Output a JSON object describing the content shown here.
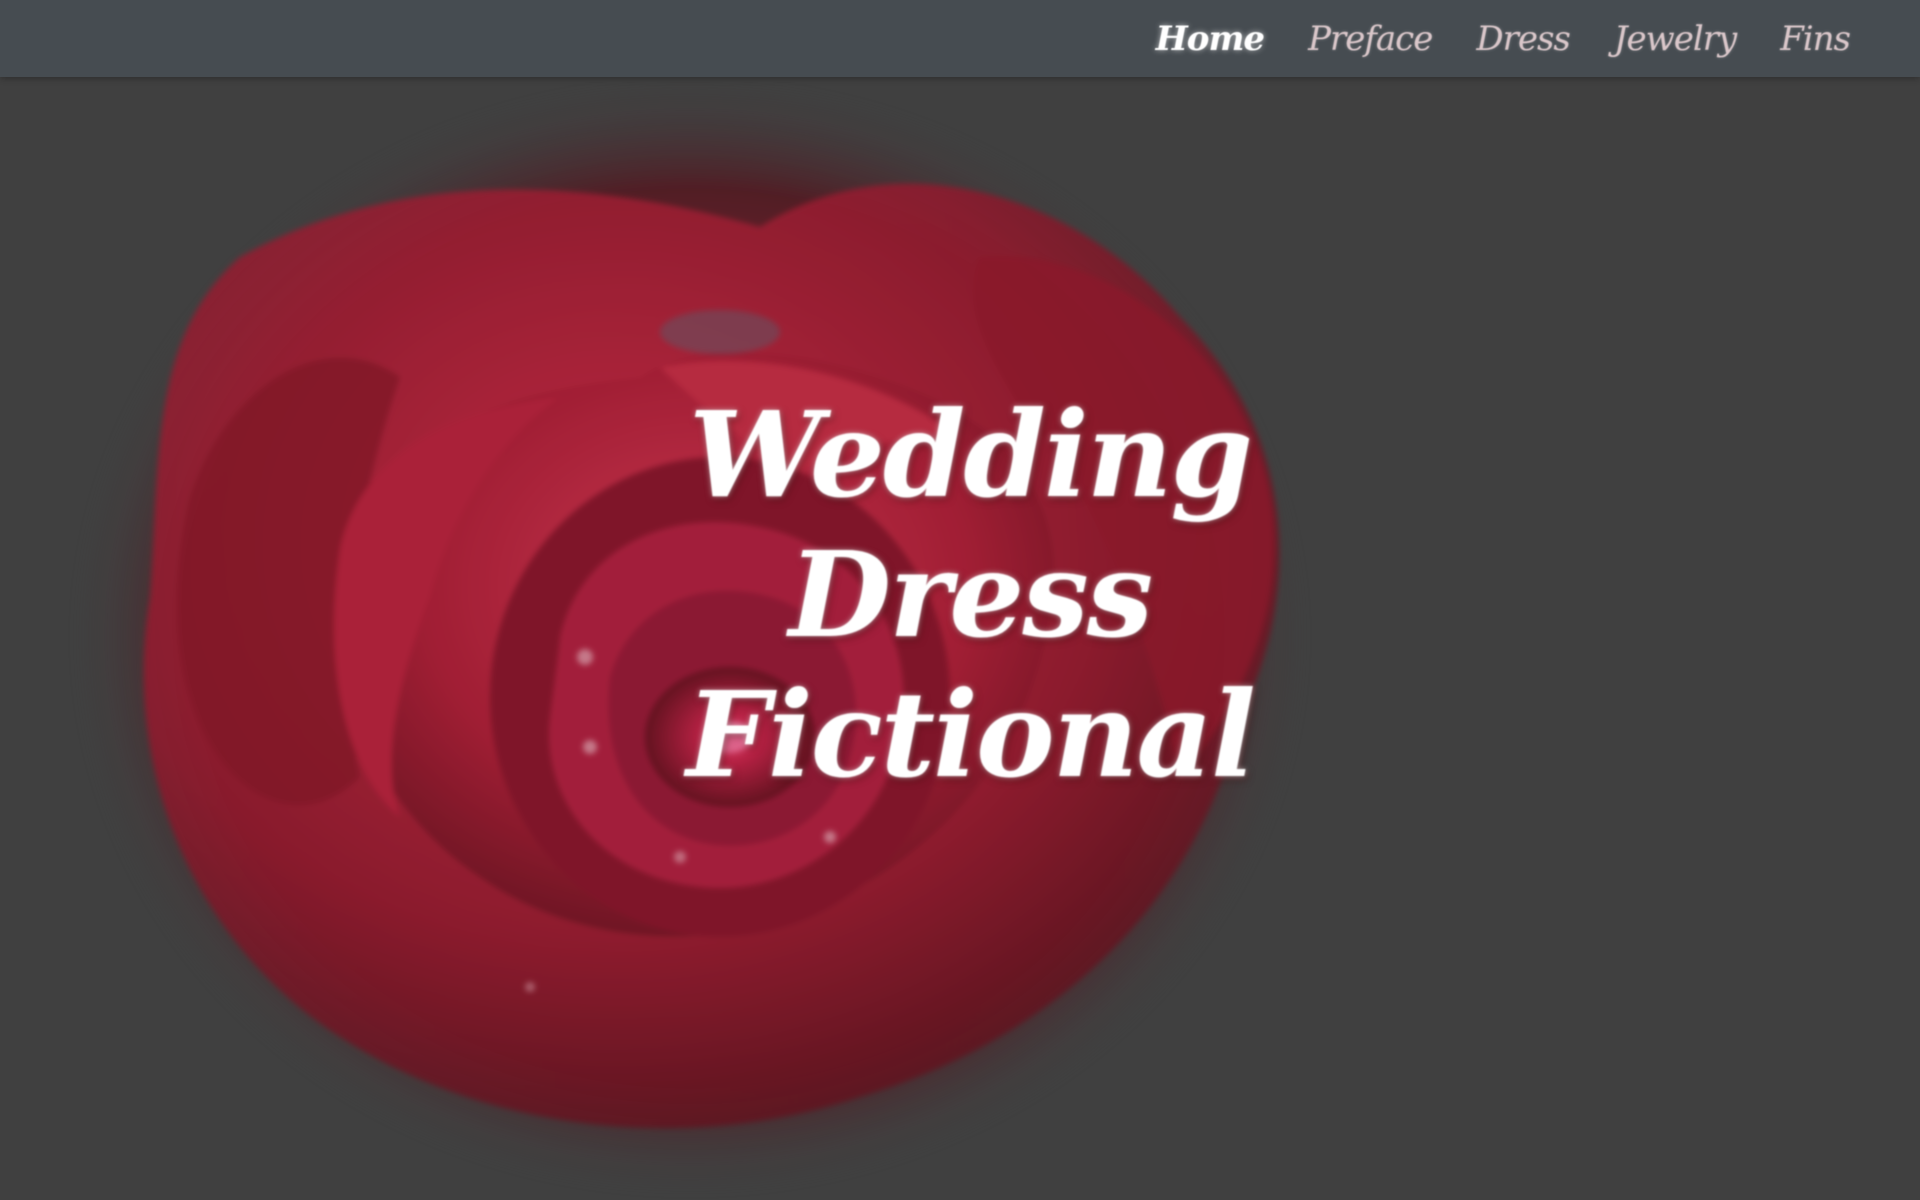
{
  "nav": {
    "items": [
      {
        "label": "Home",
        "active": true
      },
      {
        "label": "Preface",
        "active": false
      },
      {
        "label": "Dress",
        "active": false
      },
      {
        "label": "Jewelry",
        "active": false
      },
      {
        "label": "Fins",
        "active": false
      }
    ]
  },
  "hero": {
    "title_line1": "Wedding Dress",
    "title_line2": "Fictional",
    "image": "red-rose-image"
  },
  "colors": {
    "navbar": "#464c51",
    "background": "#404040",
    "rose_red": "#c4152e",
    "rose_dark": "#5a0612",
    "title_text": "#ffffff",
    "nav_text": "#d9c6c9"
  }
}
